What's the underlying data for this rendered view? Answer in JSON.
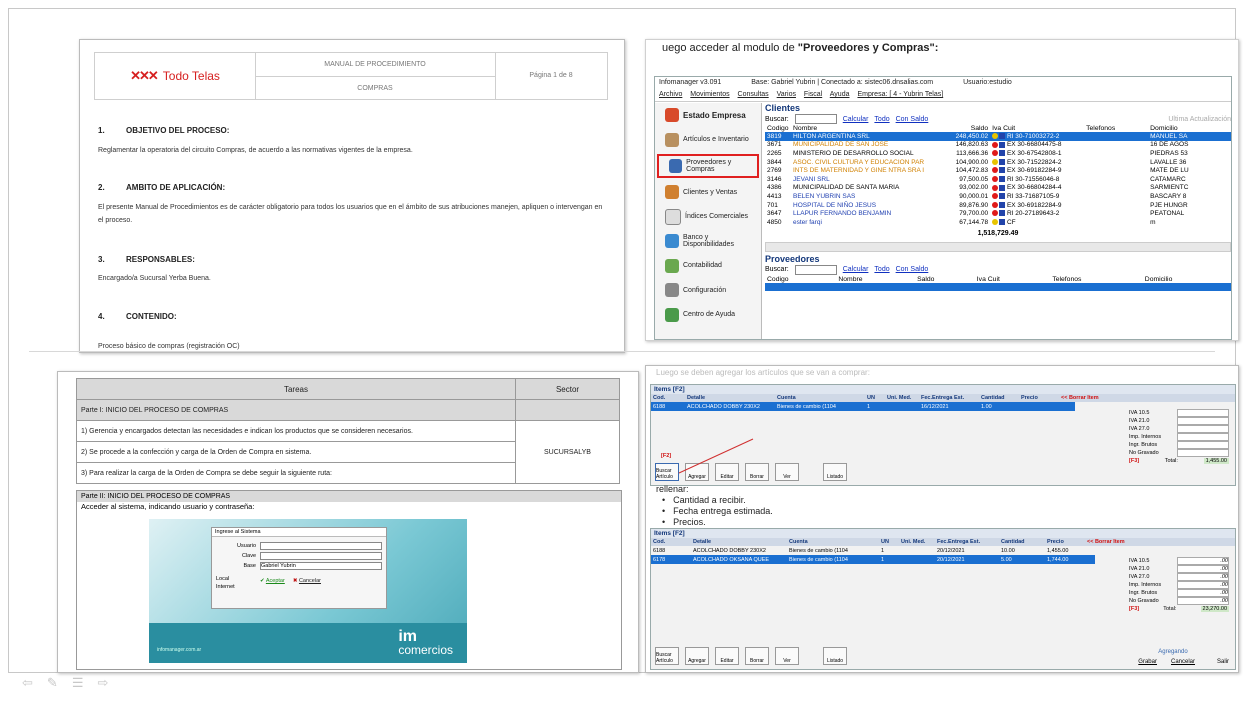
{
  "slide1": {
    "logo": "Todo Telas",
    "doc_title": "MANUAL DE PROCEDIMIENTO",
    "doc_sub": "COMPRAS",
    "page": "Página 1 de 8",
    "sections": [
      {
        "num": "1.",
        "title": "OBJETIVO DEL PROCESO:",
        "text": "Reglamentar la operatoria del circuito Compras, de acuerdo a las normativas vigentes de la empresa."
      },
      {
        "num": "2.",
        "title": "AMBITO DE APLICACIÓN:",
        "text": "El presente Manual de Procedimientos es de carácter obligatorio para todos los usuarios que en el ámbito de sus atribuciones manejen, apliquen o intervengan en el proceso."
      },
      {
        "num": "3.",
        "title": "RESPONSABLES:",
        "text": "Encargado/a Sucursal Yerba Buena."
      },
      {
        "num": "4.",
        "title": "CONTENIDO:",
        "text": "Proceso básico de compras (registración OC)"
      }
    ]
  },
  "slide2": {
    "caption_pre": "uego acceder al modulo de ",
    "caption_bold": "\"Proveedores y Compras\":",
    "app_title": "Infomanager v3.091",
    "app_base": "Base: Gabriel Yubrin | Conectado a: sistec06.dnsalias.com",
    "app_user": "Usuario:estudio",
    "menu": [
      "Archivo",
      "Movimientos",
      "Consultas",
      "Varios",
      "Fiscal",
      "Ayuda",
      "Empresa: [ 4 - Yubrin Telas]"
    ],
    "sidebar": [
      "Estado Empresa",
      "Artículos e Inventario",
      "Proveedores y Compras",
      "Clientes y Ventas",
      "Índices Comerciales",
      "Banco y Disponibilidades",
      "Contabilidad",
      "Configuración",
      "Centro de Ayuda"
    ],
    "clientes_title": "Clientes",
    "buscar": "Buscar:",
    "links": [
      "Calcular",
      "Todo",
      "Con Saldo"
    ],
    "ultima": "Ultima Actualización",
    "cols": [
      "Codigo",
      "Nombre",
      "Saldo",
      "Iva Cuit",
      "Telefonos",
      "Domicilio"
    ],
    "rows": [
      [
        "3819",
        "HILTON ARGENTINA SRL",
        "248,450.02",
        "RI 30-71003272-2",
        "",
        "MANUEL SA"
      ],
      [
        "3671",
        "MUNICIPALIDAD DE SAN JOSE",
        "146,820.63",
        "EX 30-66804475-8",
        "",
        "16 DE AGOS"
      ],
      [
        "2265",
        "MINISTERIO DE DESARROLLO SOCIAL",
        "113,666.36",
        "EX 30-67542808-1",
        "",
        "PIEDRAS 53"
      ],
      [
        "3844",
        "ASOC. CIVIL CULTURA Y EDUCACION PAR",
        "104,900.00",
        "EX 30-71522824-2",
        "",
        "LAVALLE 36"
      ],
      [
        "2769",
        "INTS DE MATERNIDAD Y GINE NTRA SRA I",
        "104,472.83",
        "EX 30-69182284-9",
        "",
        "MATE DE LU"
      ],
      [
        "3146",
        "JEVANI SRL",
        "97,500.05",
        "RI 30-71556046-8",
        "",
        "CATAMARC"
      ],
      [
        "4386",
        "MUNICIPALIDAD DE SANTA MARIA",
        "93,002.00",
        "EX 30-66804284-4",
        "",
        "SARMIENTC"
      ],
      [
        "4413",
        "BELEN YUBRIN SAS",
        "90,000.01",
        "RI 33-71687105-9",
        "",
        "BASCARY 8"
      ],
      [
        "701",
        "HOSPITAL DE NIÑO JESUS",
        "89,876.90",
        "EX 30-69182284-9",
        "",
        "PJE HUNGR"
      ],
      [
        "3647",
        "LLAPUR FERNANDO BENJAMIN",
        "79,700.00",
        "RI 20-27189643-2",
        "",
        "PEATONAL"
      ],
      [
        "4850",
        "ester farqi",
        "67,144.78",
        "CF",
        "",
        "m"
      ]
    ],
    "total": "1,518,729.49",
    "prov_title": "Proveedores",
    "prov_cols": [
      "Codigo",
      "Nombre",
      "Saldo",
      "Iva Cuit",
      "Telefonos",
      "Domicilio"
    ]
  },
  "slide3": {
    "col_tareas": "Tareas",
    "col_sector": "Sector",
    "part1": "Parte I: INICIO DEL PROCESO DE COMPRAS",
    "steps": [
      "1) Gerencia y encargados detectan las necesidades e indican los productos que se consideren necesarios.",
      "2) Se procede a la confección y carga de la Orden de Compra en sistema.",
      "3) Para realizar la carga de la Orden de Compra se debe seguir la siguiente ruta:"
    ],
    "sector": "SUCURSALYB",
    "part2": "Parte II: INICIO DEL PROCESO DE COMPRAS",
    "part2_text": "Acceder al sistema, indicando usuario y contraseña:",
    "dlg_title": "Ingrese al Sistema",
    "dlg_user": "Usuario",
    "dlg_clave": "Clave",
    "dlg_base": "Base",
    "dlg_base_val": "Gabriel Yubrin",
    "dlg_local": "Local",
    "dlg_internet": "Internet",
    "dlg_ok": "Aceptar",
    "dlg_cancel": "Cancelar",
    "brand_small": "infomanager.com.ar",
    "brand_im": "im",
    "brand_comercios": "comercios"
  },
  "slide4": {
    "caption": "Luego se deben agregar los artículos que se van a comprar:",
    "items_title": "Items [F2]",
    "cols": [
      "Cod.",
      "Detalle",
      "Cuenta",
      "UN",
      "Uni. Med.",
      "Fec.Entrega Est.",
      "Cantidad",
      "Precio"
    ],
    "borrar": "<< Borrar Item",
    "top_row": [
      "6188",
      "ACOLCHADO DOBBY 230X2",
      "Bienes de cambio (1104",
      "1",
      "",
      "16/12/2021",
      "1.00",
      ""
    ],
    "rellenar": "rellenar:",
    "bullets": [
      "Cantidad a recibir.",
      "Fecha entrega estimada.",
      "Precios."
    ],
    "rows": [
      [
        "6188",
        "ACOLCHADO DOBBY 230X2",
        "Bienes de cambio (1104",
        "1",
        "",
        "20/12/2021",
        "10.00",
        "1,455.00"
      ],
      [
        "6178",
        "ACOLCHADO OKSANA QUEE",
        "Bienes de cambio (1104",
        "1",
        "",
        "20/12/2021",
        "5.00",
        "1,744.00"
      ]
    ],
    "totals": [
      [
        "IVA 10.5",
        ".00"
      ],
      [
        "IVA 21.0",
        ".00"
      ],
      [
        "IVA 27.0",
        ".00"
      ],
      [
        "Imp. Internos",
        ".00"
      ],
      [
        "Ingr. Brutos",
        ".00"
      ],
      [
        "No Gravado",
        ".00"
      ]
    ],
    "f2": "[F2]",
    "f3": "[F3]",
    "total_label": "Total:",
    "total_top": "1,455.00",
    "total_val": "23,270.00",
    "buttons": [
      "Buscar Artículo",
      "Agregar",
      "Editar",
      "Borrar",
      "Ver",
      "Listado"
    ],
    "agregando": "Agregando",
    "grabar": "Grabar",
    "cancelar": "Cancelar",
    "salir": "Salir"
  }
}
